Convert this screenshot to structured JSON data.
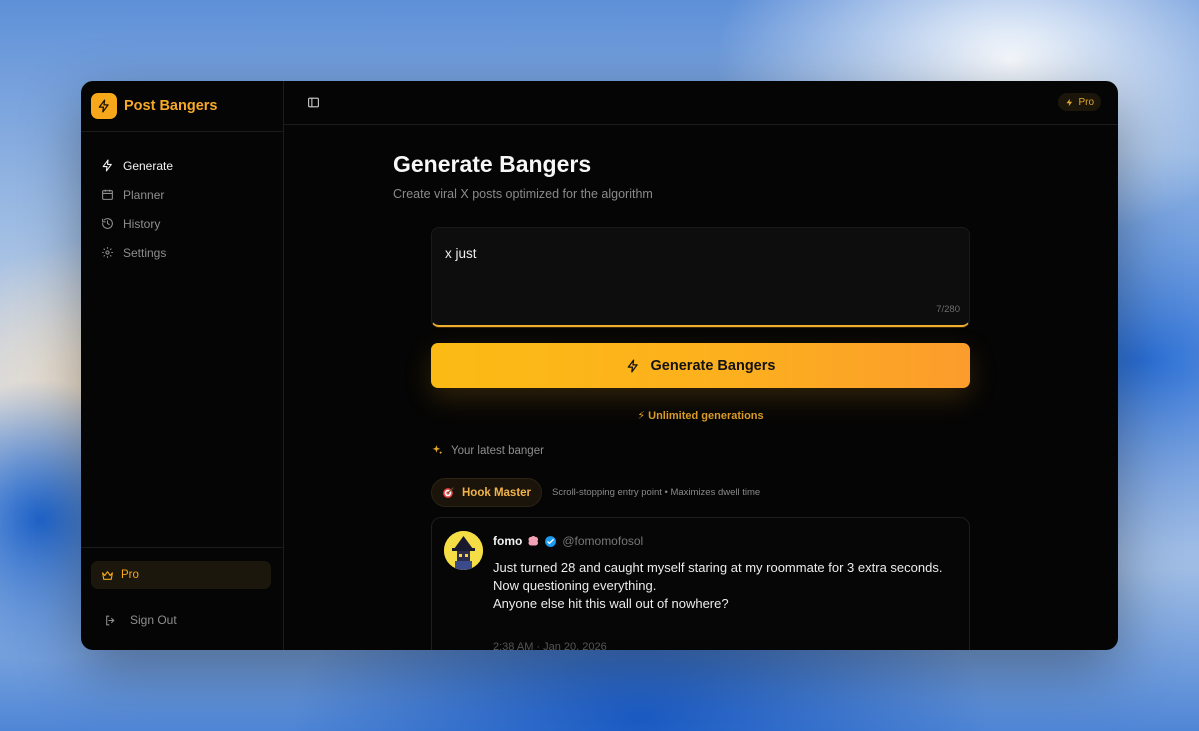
{
  "app": {
    "name": "Post Bangers"
  },
  "sidebar": {
    "items": [
      {
        "label": "Generate",
        "icon": "bolt-icon",
        "active": true
      },
      {
        "label": "Planner",
        "icon": "calendar-icon"
      },
      {
        "label": "History",
        "icon": "history-icon"
      },
      {
        "label": "Settings",
        "icon": "gear-icon"
      }
    ],
    "pro_label": "Pro",
    "signout_label": "Sign Out"
  },
  "topbar": {
    "badge": "Pro"
  },
  "page": {
    "title": "Generate Bangers",
    "subtitle": "Create viral X posts optimized for the algorithm"
  },
  "composer": {
    "value": "x just",
    "char_count": "7/280"
  },
  "generate_button": {
    "label": "Generate Bangers"
  },
  "unlimited_text": "⚡ Unlimited generations",
  "latest": {
    "label": "Your latest banger"
  },
  "hook": {
    "label": "Hook Master",
    "description": "Scroll-stopping entry point • Maximizes dwell time"
  },
  "tweet": {
    "name": "fomo",
    "handle": "@fomomofosol",
    "lines": [
      "Just turned 28 and caught myself staring at my roommate for 3 extra seconds.",
      "Now questioning everything.",
      "Anyone else hit this wall out of nowhere?"
    ],
    "timestamp": "2:38 AM · Jan 20, 2026"
  },
  "colors": {
    "accent": "#f6a81a",
    "background": "#050505"
  }
}
